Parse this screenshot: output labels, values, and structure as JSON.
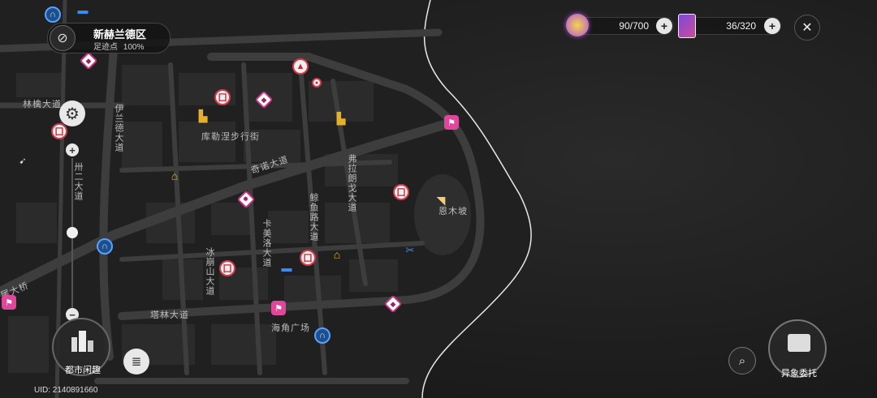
{
  "district": {
    "name": "新赫兰德区",
    "footprint_label": "足迹点",
    "footprint_value": "100%"
  },
  "resources": [
    {
      "icon": "energy-orb-icon",
      "value": "90/700"
    },
    {
      "icon": "card-pack-icon",
      "value": "36/320"
    }
  ],
  "street_labels": {
    "linyu": "林檎大道",
    "kule": "库勒涅步行街",
    "qinuo": "奇诺大道",
    "fulang": "弗拉朗戈大道",
    "luyu": "鲸鱼路大道",
    "kamei": "卡美洛大道",
    "bingshan": "冰崩山大道",
    "talin": "塔林大道",
    "haijiao": "海角广场",
    "enmu": "恩木坡",
    "yilan": "伊兰德大道",
    "weigiao": "尾大桥",
    "street_left": "卅二大道"
  },
  "bottom": {
    "city_label": "都市闲趣",
    "commission_label": "异象委托",
    "uid": "UID: 2140891660"
  },
  "colors": {
    "land": "#262626",
    "road": "#3a3a3a",
    "sea": "#1b1b1b",
    "accent_red": "#d63a4a",
    "accent_pink": "#e0479a",
    "accent_blue": "#5aa0ff"
  }
}
